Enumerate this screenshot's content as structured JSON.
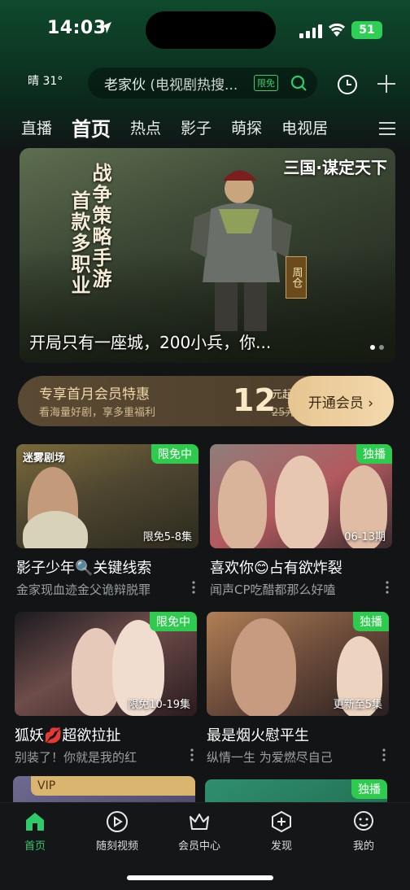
{
  "status": {
    "time": "14:03",
    "battery": "51"
  },
  "weather": {
    "label": "晴 31°"
  },
  "search": {
    "query": "老家伙",
    "hint": "(电视剧热搜...",
    "tag": "限免"
  },
  "tabs": [
    {
      "label": "直播"
    },
    {
      "label": "首页"
    },
    {
      "label": "热点"
    },
    {
      "label": "影子"
    },
    {
      "label": "萌探"
    },
    {
      "label": "电视居"
    }
  ],
  "banner": {
    "vtext_left": "首款多职业",
    "vtext_right": "战争策略手游",
    "logo": "三国·谋定天下",
    "name_tag": "周仓",
    "caption": "开局只有一座城，200小兵，你..."
  },
  "vip": {
    "title": "专享首月会员特惠",
    "subtitle": "看海量好剧，享多重福利",
    "price": "12",
    "unit": "元起",
    "old_price": "25元",
    "button": "开通会员 ›"
  },
  "cards": [
    {
      "badge": "限免中",
      "episodes": "限免5-8集",
      "studio": "迷雾剧场",
      "title": "影子少年🔍关键线索",
      "subtitle": "金家现血迹金父诡辩脱罪"
    },
    {
      "badge": "独播",
      "episodes": "06-13期",
      "studio": "",
      "title": "喜欢你😊占有欲炸裂",
      "subtitle": "闻声CP吃醋都那么好嗑"
    },
    {
      "badge": "限免中",
      "episodes": "限免10-19集",
      "studio": "",
      "title": "狐妖💋超欲拉扯",
      "subtitle": "别装了！你就是我的红"
    },
    {
      "badge": "独播",
      "episodes": "更新至5集",
      "studio": "",
      "title": "最是烟火慰平生",
      "subtitle": "纵情一生 为爱燃尽自己"
    },
    {
      "badge": "VIP",
      "episodes": "",
      "studio": "",
      "title": "",
      "subtitle": ""
    },
    {
      "badge": "独播",
      "episodes": "",
      "studio": "",
      "title": "",
      "subtitle": ""
    }
  ],
  "nav": [
    {
      "label": "首页"
    },
    {
      "label": "随刻视频"
    },
    {
      "label": "会员中心"
    },
    {
      "label": "发现"
    },
    {
      "label": "我的"
    }
  ],
  "colors": {
    "accent": "#2fcb4f",
    "gold": "#e7c591"
  }
}
